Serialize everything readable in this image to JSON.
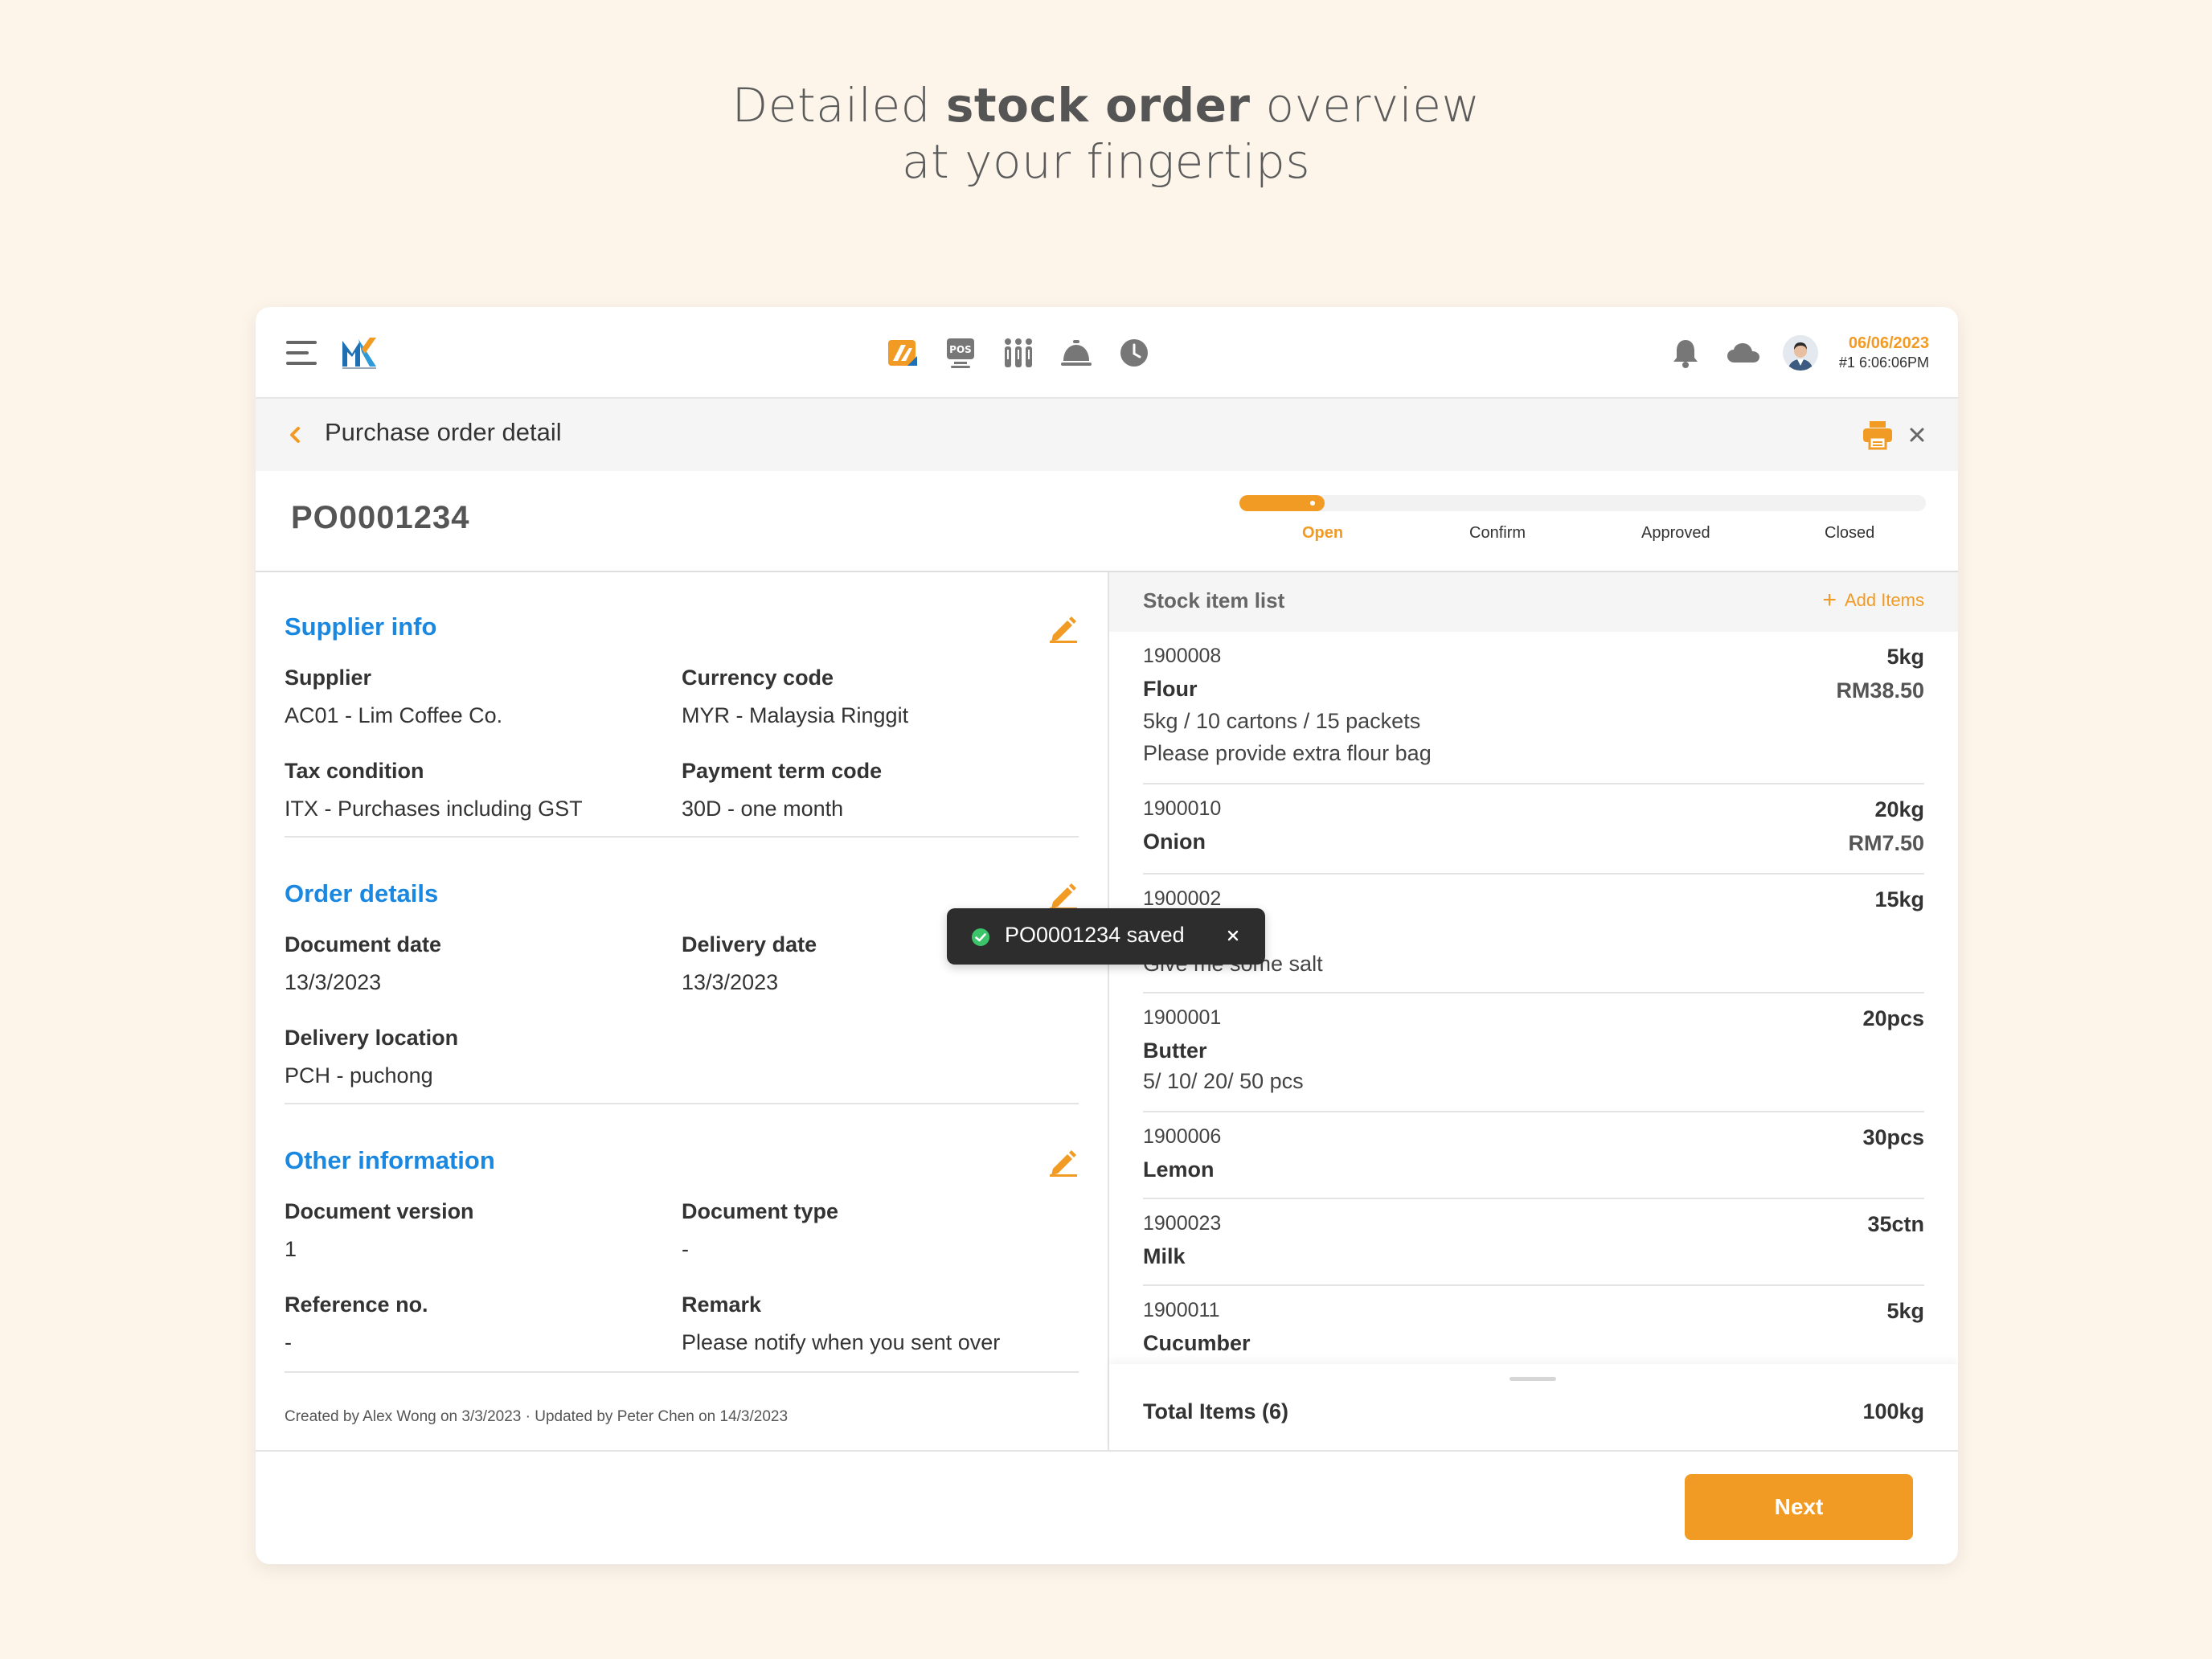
{
  "headline": {
    "pre": "Detailed ",
    "bold": "stock order",
    "post": " overview",
    "line2": "at your fingertips"
  },
  "topbar": {
    "nav_icons": [
      "brand-app-icon",
      "pos-icon",
      "staff-icon",
      "service-bell-icon",
      "clock-icon"
    ],
    "pos_label": "POS",
    "date": "06/06/2023",
    "time": "#1 6:06:06PM"
  },
  "page": {
    "title": "Purchase order detail",
    "po_number": "PO0001234"
  },
  "progress": {
    "steps": [
      "Open",
      "Confirm",
      "Approved",
      "Closed"
    ],
    "active": "Open"
  },
  "supplier_info": {
    "title": "Supplier info",
    "supplier_label": "Supplier",
    "supplier_value": "AC01 - Lim Coffee Co.",
    "currency_label": "Currency code",
    "currency_value": "MYR - Malaysia Ringgit",
    "tax_label": "Tax condition",
    "tax_value": "ITX - Purchases including GST",
    "payment_label": "Payment term code",
    "payment_value": "30D - one month"
  },
  "order_details": {
    "title": "Order details",
    "doc_date_label": "Document date",
    "doc_date_value": "13/3/2023",
    "delivery_date_label": "Delivery date",
    "delivery_date_value": "13/3/2023",
    "location_label": "Delivery location",
    "location_value": "PCH - puchong"
  },
  "other_info": {
    "title": "Other information",
    "version_label": "Document version",
    "version_value": "1",
    "type_label": "Document type",
    "type_value": "-",
    "ref_label": "Reference no.",
    "ref_value": "-",
    "remark_label": "Remark",
    "remark_value": "Please notify when you sent over"
  },
  "footnote": "Created by Alex Wong on 3/3/2023 · Updated by Peter Chen on 14/3/2023",
  "stock_list": {
    "title": "Stock item list",
    "add_label": "Add Items",
    "items": [
      {
        "code": "1900008",
        "name": "Flour",
        "line3": "5kg / 10 cartons / 15 packets",
        "line4": "Please provide extra flour bag",
        "qty": "5kg",
        "price": "RM38.50"
      },
      {
        "code": "1900010",
        "name": "Onion",
        "qty": "20kg",
        "price": "RM7.50"
      },
      {
        "code": "1900002",
        "line3": "Give me some salt",
        "qty": "15kg"
      },
      {
        "code": "1900001",
        "name": "Butter",
        "line3": "5/ 10/ 20/ 50 pcs",
        "qty": "20pcs"
      },
      {
        "code": "1900006",
        "name": "Lemon",
        "qty": "30pcs"
      },
      {
        "code": "1900023",
        "name": "Milk",
        "qty": "35ctn"
      },
      {
        "code": "1900011",
        "name": "Cucumber",
        "qty": "5kg"
      }
    ],
    "total_label": "Total Items (6)",
    "total_value": "100kg"
  },
  "toast": {
    "message": "PO0001234 saved"
  },
  "footer": {
    "next_label": "Next"
  },
  "colors": {
    "accent": "#f29b24",
    "link": "#1a87e0",
    "background": "#fdf5ea",
    "toast": "#2d2d2d"
  }
}
